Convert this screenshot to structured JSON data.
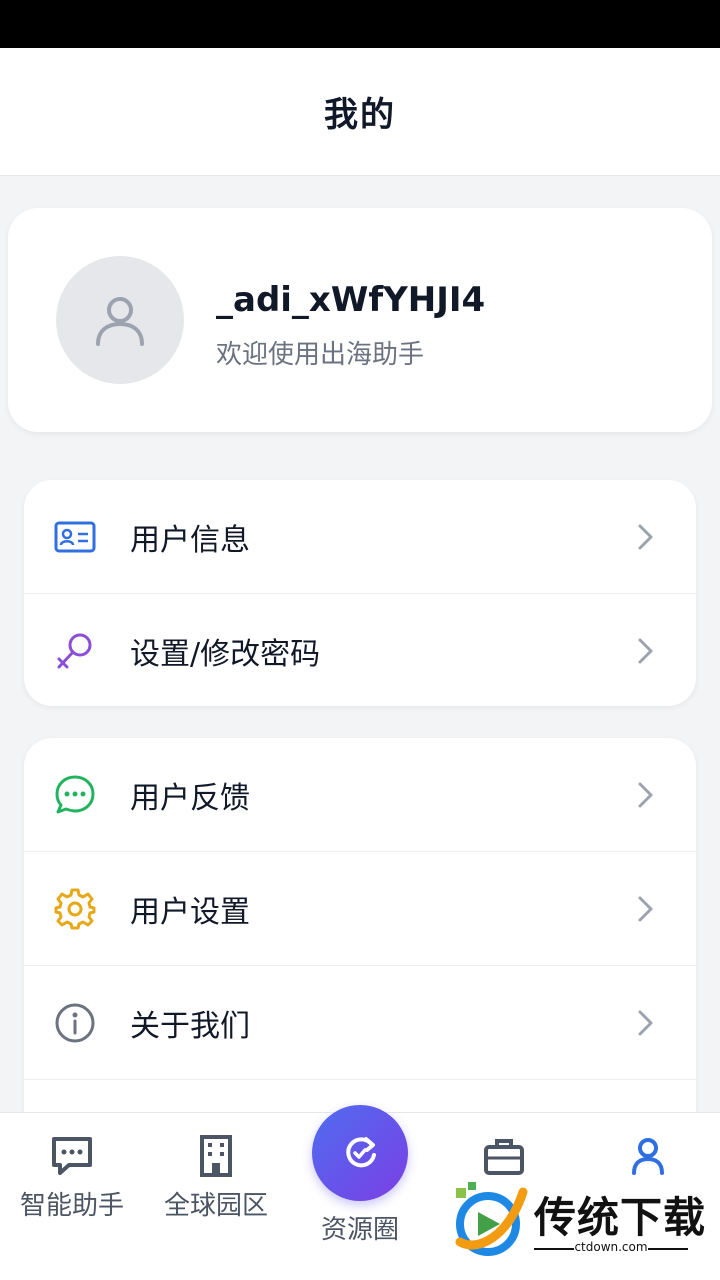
{
  "header": {
    "title": "我的"
  },
  "profile": {
    "username": "_adi_xWfYHJI4",
    "welcome": "欢迎使用出海助手"
  },
  "menu_group1": [
    {
      "label": "用户信息",
      "icon": "id-card-icon",
      "color": "#2f6fe0"
    },
    {
      "label": "设置/修改密码",
      "icon": "key-icon",
      "color": "#8b4fd8"
    }
  ],
  "menu_group2": [
    {
      "label": "用户反馈",
      "icon": "chat-dots-icon",
      "color": "#22b35e"
    },
    {
      "label": "用户设置",
      "icon": "gear-icon",
      "color": "#e6a817"
    },
    {
      "label": "关于我们",
      "icon": "info-icon",
      "color": "#6b7280"
    }
  ],
  "tabbar": {
    "tabs": [
      {
        "label": "智能助手",
        "icon": "chat-bubble-icon"
      },
      {
        "label": "全球园区",
        "icon": "building-icon"
      },
      {
        "label": "资源圈",
        "icon": "refresh-icon"
      },
      {
        "label": "",
        "icon": "briefcase-icon"
      },
      {
        "label": "",
        "icon": "user-icon"
      }
    ],
    "accent": "#2f6fe0"
  },
  "watermark": {
    "title": "传统下载",
    "url": "ctdown.com"
  }
}
